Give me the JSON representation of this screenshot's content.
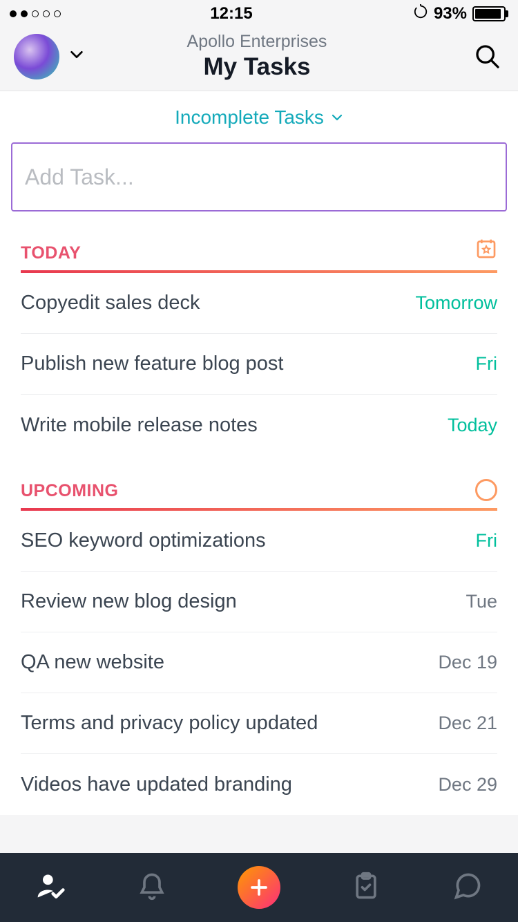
{
  "status_bar": {
    "time": "12:15",
    "battery_pct": "93%"
  },
  "header": {
    "org": "Apollo Enterprises",
    "title": "My Tasks"
  },
  "filter": {
    "label": "Incomplete Tasks"
  },
  "add_task": {
    "placeholder": "Add Task..."
  },
  "sections": [
    {
      "title": "TODAY",
      "icon": "star-calendar",
      "tasks": [
        {
          "title": "Copyedit sales deck",
          "due": "Tomorrow",
          "due_style": "green"
        },
        {
          "title": "Publish new feature blog post",
          "due": "Fri",
          "due_style": "green"
        },
        {
          "title": "Write mobile release notes",
          "due": "Today",
          "due_style": "green"
        }
      ]
    },
    {
      "title": "UPCOMING",
      "icon": "circle",
      "tasks": [
        {
          "title": "SEO keyword optimizations",
          "due": "Fri",
          "due_style": "green"
        },
        {
          "title": "Review new blog design",
          "due": "Tue",
          "due_style": "gray"
        },
        {
          "title": "QA new website",
          "due": "Dec 19",
          "due_style": "gray"
        },
        {
          "title": "Terms and privacy policy updated",
          "due": "Dec 21",
          "due_style": "gray"
        },
        {
          "title": "Videos have updated branding",
          "due": "Dec 29",
          "due_style": "gray"
        }
      ]
    }
  ]
}
